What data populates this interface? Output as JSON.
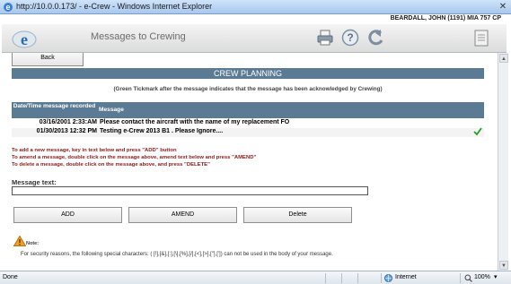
{
  "window": {
    "title": "http://10.0.0.173/ - e-Crew - Windows Internet Explorer",
    "close_glyph": "✕"
  },
  "header": {
    "user": "BEARDALL, JOHN (1191) MIA 757 CP",
    "page_title": "Messages to Crewing",
    "icons": [
      "e-crew-logo-icon",
      "printer-icon",
      "help-icon",
      "back-arrow-icon",
      "document-icon"
    ]
  },
  "content": {
    "back_label": "Back",
    "section_title": "CREW PLANNING",
    "tick_note": "(Green Tickmark after the message indicates that the message has been acknowledged by Crewing)",
    "table": {
      "columns": [
        "Date/Time message recorded",
        "Message"
      ],
      "rows": [
        {
          "datetime": "03/16/2001 2:33:AM",
          "message": "Please contact the aircraft with the name of my replacement FO",
          "acknowledged": false
        },
        {
          "datetime": "01/30/2013 12:32 PM",
          "message": "Testing e-Crew 2013 B1 . Please Ignore....",
          "acknowledged": true
        }
      ]
    },
    "instructions": [
      "To add a new message, key in text below and press \"ADD\" button",
      "To amend a message, double click on the message above, amend text below and press \"AMEND\"",
      "To delete a message, double click on the message above, and press \"DELETE\""
    ],
    "message_label": "Message text:",
    "message_value": "",
    "buttons": {
      "add": "ADD",
      "amend": "AMEND",
      "delete": "Delete"
    },
    "note_label": "Note:",
    "security_note": "For security reasons, the following special characters: ( [!],[&],[:],[\\],[%],[/],[<],[>],[\"],[']) can not be used in the body of your message."
  },
  "statusbar": {
    "status": "Done",
    "zone": "Internet",
    "zoom": "100%",
    "zoom_dropdown": "▾"
  },
  "colors": {
    "accent": "#5b7a93",
    "instruction_red": "#8b1a1a",
    "tick_green": "#2e9a2e"
  }
}
